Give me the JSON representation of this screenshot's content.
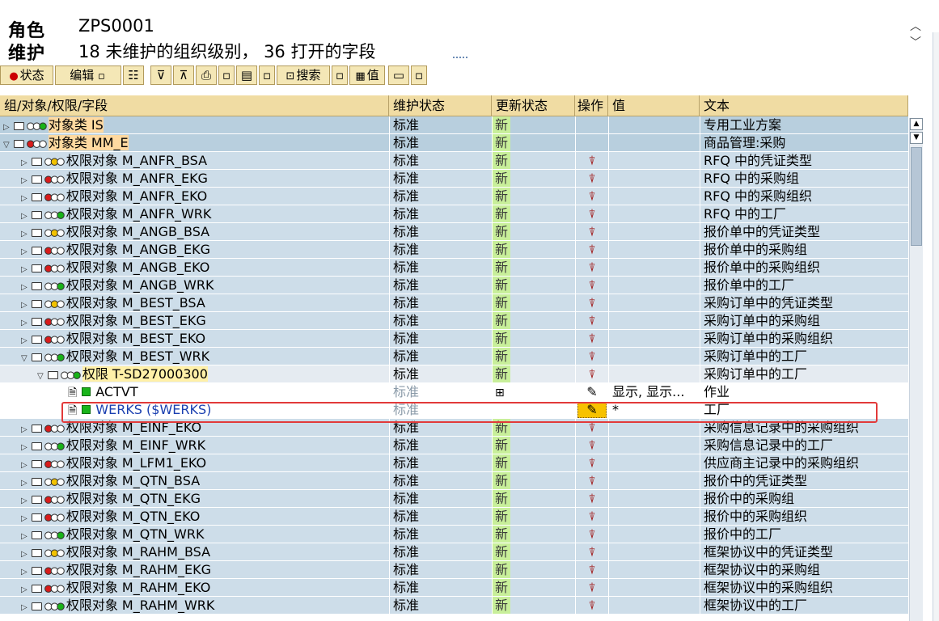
{
  "header": {
    "role_label": "角色",
    "role_value": "ZPS0001",
    "maint_label": "维护",
    "maint_value": "18 未维护的组织级别， 36 打开的字段"
  },
  "toolbar": {
    "status": "状态",
    "edit": "编辑",
    "search": "搜索",
    "value": "值"
  },
  "columns": {
    "tree": "组/对象/权限/字段",
    "maint": "维护状态",
    "update": "更新状态",
    "op": "操作",
    "value": "值",
    "text": "文本"
  },
  "rows": [
    {
      "kind": "cls",
      "exp": "▷",
      "lights": "ooG",
      "label": "对象类 IS",
      "maint": "标准",
      "upd": "新",
      "op": "",
      "val": "",
      "text": "专用工业方案"
    },
    {
      "kind": "cls",
      "exp": "▽",
      "lights": "Roo",
      "label": "对象类 MM_E",
      "maint": "标准",
      "upd": "新",
      "op": "",
      "val": "",
      "text": "商品管理:采购"
    },
    {
      "kind": "obj",
      "exp": "▷",
      "lights": "oYo",
      "label": "权限对象 M_ANFR_BSA",
      "maint": "标准",
      "upd": "新",
      "op": "trash",
      "val": "",
      "text": "RFQ 中的凭证类型"
    },
    {
      "kind": "obj",
      "exp": "▷",
      "lights": "Roo",
      "label": "权限对象 M_ANFR_EKG",
      "maint": "标准",
      "upd": "新",
      "op": "trash",
      "val": "",
      "text": "RFQ 中的采购组"
    },
    {
      "kind": "obj",
      "exp": "▷",
      "lights": "Roo",
      "label": "权限对象 M_ANFR_EKO",
      "maint": "标准",
      "upd": "新",
      "op": "trash",
      "val": "",
      "text": "RFQ 中的采购组织"
    },
    {
      "kind": "obj",
      "exp": "▷",
      "lights": "ooG",
      "label": "权限对象 M_ANFR_WRK",
      "maint": "标准",
      "upd": "新",
      "op": "trash",
      "val": "",
      "text": "RFQ 中的工厂"
    },
    {
      "kind": "obj",
      "exp": "▷",
      "lights": "oYo",
      "label": "权限对象 M_ANGB_BSA",
      "maint": "标准",
      "upd": "新",
      "op": "trash",
      "val": "",
      "text": "报价单中的凭证类型"
    },
    {
      "kind": "obj",
      "exp": "▷",
      "lights": "Roo",
      "label": "权限对象 M_ANGB_EKG",
      "maint": "标准",
      "upd": "新",
      "op": "trash",
      "val": "",
      "text": "报价单中的采购组"
    },
    {
      "kind": "obj",
      "exp": "▷",
      "lights": "Roo",
      "label": "权限对象 M_ANGB_EKO",
      "maint": "标准",
      "upd": "新",
      "op": "trash",
      "val": "",
      "text": "报价单中的采购组织"
    },
    {
      "kind": "obj",
      "exp": "▷",
      "lights": "ooG",
      "label": "权限对象 M_ANGB_WRK",
      "maint": "标准",
      "upd": "新",
      "op": "trash",
      "val": "",
      "text": "报价单中的工厂"
    },
    {
      "kind": "obj",
      "exp": "▷",
      "lights": "oYo",
      "label": "权限对象 M_BEST_BSA",
      "maint": "标准",
      "upd": "新",
      "op": "trash",
      "val": "",
      "text": "采购订单中的凭证类型"
    },
    {
      "kind": "obj",
      "exp": "▷",
      "lights": "Roo",
      "label": "权限对象 M_BEST_EKG",
      "maint": "标准",
      "upd": "新",
      "op": "trash",
      "val": "",
      "text": "采购订单中的采购组"
    },
    {
      "kind": "obj",
      "exp": "▷",
      "lights": "Roo",
      "label": "权限对象 M_BEST_EKO",
      "maint": "标准",
      "upd": "新",
      "op": "trash",
      "val": "",
      "text": "采购订单中的采购组织"
    },
    {
      "kind": "obj",
      "exp": "▽",
      "lights": "ooG",
      "label": "权限对象 M_BEST_WRK",
      "maint": "标准",
      "upd": "新",
      "op": "trash",
      "val": "",
      "text": "采购订单中的工厂"
    },
    {
      "kind": "auth",
      "exp": "▽",
      "lights": "ooG",
      "label": "权限 T-SD27000300",
      "maint": "标准",
      "upd": "新",
      "op": "trash",
      "val": "",
      "text": "采购订单中的工厂"
    },
    {
      "kind": "field",
      "exp": "",
      "lights": "",
      "label": "ACTVT",
      "maint": "标准",
      "upd": "",
      "op": "pencil",
      "val": "显示, 显示...",
      "text": "作业",
      "upd_icon": "edit"
    },
    {
      "kind": "field",
      "exp": "",
      "lights": "",
      "label": "WERKS ($WERKS)",
      "maint": "标准",
      "upd": "",
      "op": "pencil-sel",
      "val": "*",
      "text": "工厂"
    },
    {
      "kind": "obj",
      "exp": "▷",
      "lights": "Roo",
      "label": "权限对象 M_EINF_EKO",
      "maint": "标准",
      "upd": "新",
      "op": "trash",
      "val": "",
      "text": "采购信息记录中的采购组织"
    },
    {
      "kind": "obj",
      "exp": "▷",
      "lights": "ooG",
      "label": "权限对象 M_EINF_WRK",
      "maint": "标准",
      "upd": "新",
      "op": "trash",
      "val": "",
      "text": "采购信息记录中的工厂"
    },
    {
      "kind": "obj",
      "exp": "▷",
      "lights": "Roo",
      "label": "权限对象 M_LFM1_EKO",
      "maint": "标准",
      "upd": "新",
      "op": "trash",
      "val": "",
      "text": "供应商主记录中的采购组织"
    },
    {
      "kind": "obj",
      "exp": "▷",
      "lights": "oYo",
      "label": "权限对象 M_QTN_BSA",
      "maint": "标准",
      "upd": "新",
      "op": "trash",
      "val": "",
      "text": "报价中的凭证类型"
    },
    {
      "kind": "obj",
      "exp": "▷",
      "lights": "Roo",
      "label": "权限对象 M_QTN_EKG",
      "maint": "标准",
      "upd": "新",
      "op": "trash",
      "val": "",
      "text": "报价中的采购组"
    },
    {
      "kind": "obj",
      "exp": "▷",
      "lights": "Roo",
      "label": "权限对象 M_QTN_EKO",
      "maint": "标准",
      "upd": "新",
      "op": "trash",
      "val": "",
      "text": "报价中的采购组织"
    },
    {
      "kind": "obj",
      "exp": "▷",
      "lights": "ooG",
      "label": "权限对象 M_QTN_WRK",
      "maint": "标准",
      "upd": "新",
      "op": "trash",
      "val": "",
      "text": "报价中的工厂"
    },
    {
      "kind": "obj",
      "exp": "▷",
      "lights": "oYo",
      "label": "权限对象 M_RAHM_BSA",
      "maint": "标准",
      "upd": "新",
      "op": "trash",
      "val": "",
      "text": "框架协议中的凭证类型"
    },
    {
      "kind": "obj",
      "exp": "▷",
      "lights": "Roo",
      "label": "权限对象 M_RAHM_EKG",
      "maint": "标准",
      "upd": "新",
      "op": "trash",
      "val": "",
      "text": "框架协议中的采购组"
    },
    {
      "kind": "obj",
      "exp": "▷",
      "lights": "Roo",
      "label": "权限对象 M_RAHM_EKO",
      "maint": "标准",
      "upd": "新",
      "op": "trash",
      "val": "",
      "text": "框架协议中的采购组织"
    },
    {
      "kind": "obj",
      "exp": "▷",
      "lights": "ooG",
      "label": "权限对象 M_RAHM_WRK",
      "maint": "标准",
      "upd": "新",
      "op": "trash",
      "val": "",
      "text": "框架协议中的工厂"
    }
  ],
  "colors": {
    "selection_outline": "#e23a3a",
    "new_status": "#c8ef9a",
    "header_bg": "#f0dca3"
  }
}
